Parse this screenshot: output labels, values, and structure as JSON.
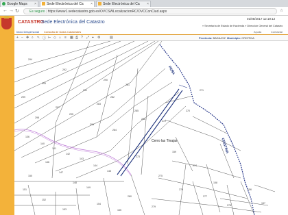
{
  "browser": {
    "tabs": [
      {
        "label": "Google Maps"
      },
      {
        "label": "Sede Electrónica del Ca"
      },
      {
        "label": "Sede Electrónica del Ca"
      }
    ],
    "address": {
      "security_label": "Es seguro",
      "url": "https://www1.sedecatastro.gob.es/OVCSWLocalizacionRC/OVCConCiud.aspx"
    }
  },
  "site": {
    "logo_text": "CATASTRO",
    "title": "Sede Electrónica del Catastro",
    "datetime": "01/08/2017 12:19:12",
    "ministry_links": "» Secretaría de Estado de Hacienda  » Dirección General del Catastro"
  },
  "menu": {
    "items": [
      "Inicio Despersonal",
      "Consulta de Datos Catastrales"
    ],
    "right": [
      "Ayuda",
      "Contactar"
    ]
  },
  "map_header": {
    "province_label": "Provincia:",
    "province_value": "BADAJOZ",
    "municipality_label": "Municipio:",
    "municipality_value": "CRISTINA"
  },
  "map": {
    "place_name": "Cerro las Tinajas",
    "feature_labels": [
      "PEÑA",
      "CRISTINA"
    ],
    "parcel_labels": [
      "281",
      "282",
      "283",
      "284",
      "285",
      "286",
      "270",
      "271",
      "272",
      "273",
      "274",
      "275",
      "276",
      "277",
      "278",
      "279",
      "280",
      "290",
      "291",
      "292",
      "293",
      "294",
      "295",
      "296",
      "297",
      "298",
      "299",
      "136",
      "140",
      "141",
      "142",
      "143",
      "144",
      "145",
      "146",
      "147",
      "148",
      "149",
      "150",
      "151",
      "152",
      "153",
      "154",
      "155",
      "156",
      "157",
      "158",
      "159"
    ]
  },
  "colors": {
    "sidebar": "#f3b23a",
    "path": "#1a2f7a",
    "boundary": "#2b3b8c"
  }
}
